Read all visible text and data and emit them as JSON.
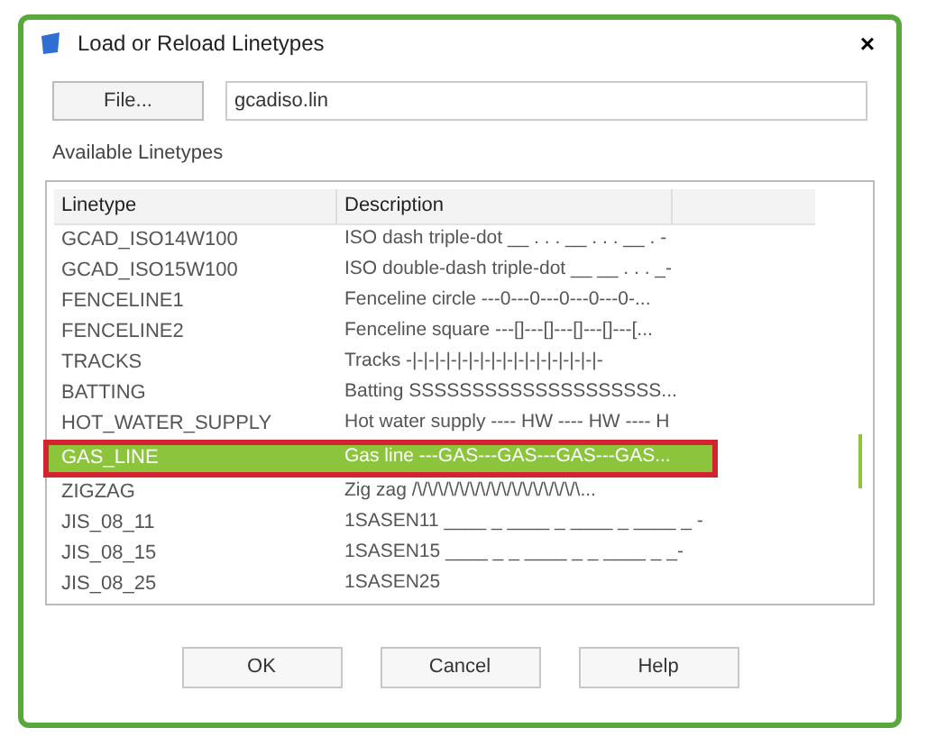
{
  "window": {
    "title": "Load or Reload Linetypes",
    "close": "×"
  },
  "file": {
    "button": "File...",
    "value": "gcadiso.lin"
  },
  "list": {
    "label": "Available Linetypes",
    "columns": [
      "Linetype",
      "Description"
    ],
    "rows": [
      {
        "name": "GCAD_ISO14W100",
        "description": "ISO dash triple-dot __ . . . __ . . . __ . -",
        "selected": false
      },
      {
        "name": "GCAD_ISO15W100",
        "description": "ISO double-dash triple-dot __ __ . . . _-",
        "selected": false
      },
      {
        "name": "FENCELINE1",
        "description": "Fenceline circle ---0---0---0---0---0-...",
        "selected": false
      },
      {
        "name": "FENCELINE2",
        "description": "Fenceline square ---[]---[]---[]---[]---[...",
        "selected": false
      },
      {
        "name": "TRACKS",
        "description": "Tracks -|-|-|-|-|-|-|-|-|-|-|-|-|-|-|-|-|-",
        "selected": false
      },
      {
        "name": "BATTING",
        "description": "Batting SSSSSSSSSSSSSSSSSSSS...",
        "selected": false
      },
      {
        "name": "HOT_WATER_SUPPLY",
        "description": "Hot water supply ---- HW ---- HW ---- H",
        "selected": false
      },
      {
        "name": "GAS_LINE",
        "description": "Gas line ---GAS---GAS---GAS---GAS...",
        "selected": true
      },
      {
        "name": "ZIGZAG",
        "description": "Zig zag /\\/\\/\\/\\/\\/\\/\\/\\/\\/\\/\\/\\/\\/\\/\\/\\...",
        "selected": false
      },
      {
        "name": "JIS_08_11",
        "description": "1SASEN11 ____ _ ____ _ ____ _ ____ _ -",
        "selected": false
      },
      {
        "name": "JIS_08_15",
        "description": "1SASEN15 ____ _ _ ____ _ _ ____ _ _-",
        "selected": false
      },
      {
        "name": "JIS_08_25",
        "description": "1SASEN25",
        "selected": false
      }
    ]
  },
  "buttons": [
    "OK",
    "Cancel",
    "Help"
  ]
}
